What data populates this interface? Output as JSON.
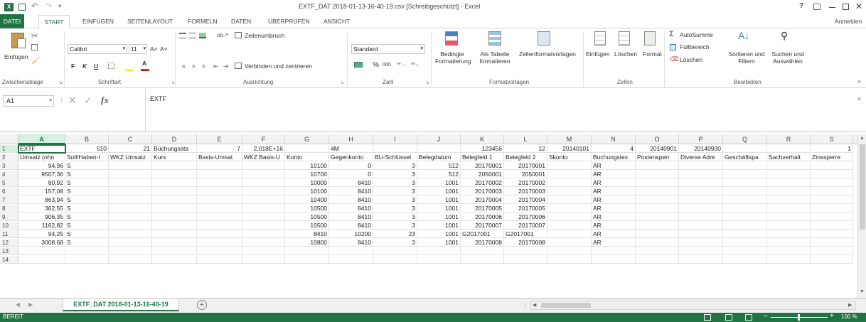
{
  "window": {
    "title": "EXTF_DAT 2018-01-13-16-40-19.csv  [Schreibgeschützt] - Excel",
    "help": "?",
    "signin": "Anmelden"
  },
  "tabs": [
    {
      "label": "DATEI",
      "active": false
    },
    {
      "label": "START",
      "active": true
    },
    {
      "label": "EINFÜGEN",
      "active": false
    },
    {
      "label": "SEITENLAYOUT",
      "active": false
    },
    {
      "label": "FORMELN",
      "active": false
    },
    {
      "label": "DATEN",
      "active": false
    },
    {
      "label": "ÜBERPRÜFEN",
      "active": false
    },
    {
      "label": "ANSICHT",
      "active": false
    }
  ],
  "ribbon": {
    "clipboard": {
      "paste": "Einfügen",
      "group": "Zwischenablage"
    },
    "font": {
      "name": "Calibri",
      "size": "11",
      "bold": "F",
      "italic": "K",
      "underline": "U",
      "group": "Schriftart"
    },
    "alignment": {
      "wrap": "Zeilenumbruch",
      "merge": "Verbinden und zentrieren",
      "group": "Ausrichtung"
    },
    "number": {
      "format": "Standard",
      "percent": "%",
      "thousands": "000",
      "group": "Zahl"
    },
    "styles": {
      "conditional": "Bedingte Formatierung",
      "table": "Als Tabelle formatieren",
      "cellstyles": "Zellenformatvorlagen",
      "group": "Formatvorlagen"
    },
    "cells": {
      "insert": "Einfügen",
      "delete": "Löschen",
      "format": "Format",
      "group": "Zellen"
    },
    "editing": {
      "autosum": "AutoSumme",
      "fill": "Füllbereich",
      "clear": "Löschen",
      "sort": "Sortieren und Filtern",
      "find": "Suchen und Auswählen",
      "group": "Bearbeiten"
    }
  },
  "formula_bar": {
    "namebox": "A1",
    "fx": "fx",
    "content": "EXTF"
  },
  "columns": [
    "A",
    "B",
    "C",
    "D",
    "E",
    "F",
    "G",
    "H",
    "I",
    "J",
    "K",
    "L",
    "M",
    "N",
    "O",
    "P",
    "Q",
    "R",
    "S"
  ],
  "rows": [
    [
      "EXTF",
      "510",
      "21",
      "Buchungssta",
      "7",
      "2,018E+16",
      "",
      "4M",
      "",
      "",
      "123456",
      "12",
      "20140101",
      "4",
      "20140901",
      "20140930",
      "",
      "",
      "1"
    ],
    [
      "Umsatz (ohn",
      "Soll/Haben-I",
      "WKZ Umsatz",
      "Kurs",
      "Basis-Umsat",
      "WKZ Basis-U",
      "Konto",
      "Gegenkonto",
      "BU-Schlüssel",
      "Belegdatum",
      "Belegfeld 1",
      "Belegfeld 2",
      "Skonto",
      "Buchungstex",
      "Postensperr",
      "Diverse Adre",
      "Geschäftspa",
      "Sachverhalt",
      "Zinssperre"
    ],
    [
      "94,96",
      "S",
      "",
      "",
      "",
      "",
      "10100",
      "0",
      "3",
      "512",
      "20170001",
      "20170001",
      "",
      "AR",
      "",
      "",
      "",
      "",
      ""
    ],
    [
      "9507,36",
      "S",
      "",
      "",
      "",
      "",
      "10700",
      "0",
      "3",
      "512",
      "2050001",
      "2050001",
      "",
      "AR",
      "",
      "",
      "",
      "",
      ""
    ],
    [
      "80,92",
      "S",
      "",
      "",
      "",
      "",
      "10000",
      "8410",
      "3",
      "1001",
      "20170002",
      "20170002",
      "",
      "AR",
      "",
      "",
      "",
      "",
      ""
    ],
    [
      "157,08",
      "S",
      "",
      "",
      "",
      "",
      "10100",
      "8410",
      "3",
      "1001",
      "20170003",
      "20170003",
      "",
      "AR",
      "",
      "",
      "",
      "",
      ""
    ],
    [
      "863,94",
      "S",
      "",
      "",
      "",
      "",
      "10400",
      "8410",
      "3",
      "1001",
      "20170004",
      "20170004",
      "",
      "AR",
      "",
      "",
      "",
      "",
      ""
    ],
    [
      "362,55",
      "S",
      "",
      "",
      "",
      "",
      "10500",
      "8410",
      "3",
      "1001",
      "20170005",
      "20170005",
      "",
      "AR",
      "",
      "",
      "",
      "",
      ""
    ],
    [
      "906,35",
      "S",
      "",
      "",
      "",
      "",
      "10500",
      "8410",
      "3",
      "1001",
      "20170006",
      "20170006",
      "",
      "AR",
      "",
      "",
      "",
      "",
      ""
    ],
    [
      "1162,82",
      "S",
      "",
      "",
      "",
      "",
      "10500",
      "8410",
      "3",
      "1001",
      "20170007",
      "20170007",
      "",
      "AR",
      "",
      "",
      "",
      "",
      ""
    ],
    [
      "94,25",
      "S",
      "",
      "",
      "",
      "",
      "8410",
      "10200",
      "23",
      "1001",
      "G2017001",
      "G2017001",
      "",
      "AR",
      "",
      "",
      "",
      "",
      ""
    ],
    [
      "3008,68",
      "S",
      "",
      "",
      "",
      "",
      "10800",
      "8410",
      "3",
      "1001",
      "20170008",
      "20170008",
      "",
      "AR",
      "",
      "",
      "",
      "",
      ""
    ],
    [
      "",
      "",
      "",
      "",
      "",
      "",
      "",
      "",
      "",
      "",
      "",
      "",
      "",
      "",
      "",
      "",
      "",
      "",
      ""
    ],
    [
      "",
      "",
      "",
      "",
      "",
      "",
      "",
      "",
      "",
      "",
      "",
      "",
      "",
      "",
      "",
      "",
      "",
      "",
      ""
    ]
  ],
  "sheet_tab": "EXTF_DAT 2018-01-13-16-40-19",
  "status": {
    "ready": "BEREIT",
    "zoom": "100 %"
  },
  "colors": {
    "accent": "#217346",
    "selected_header": "#d3f0e0"
  }
}
